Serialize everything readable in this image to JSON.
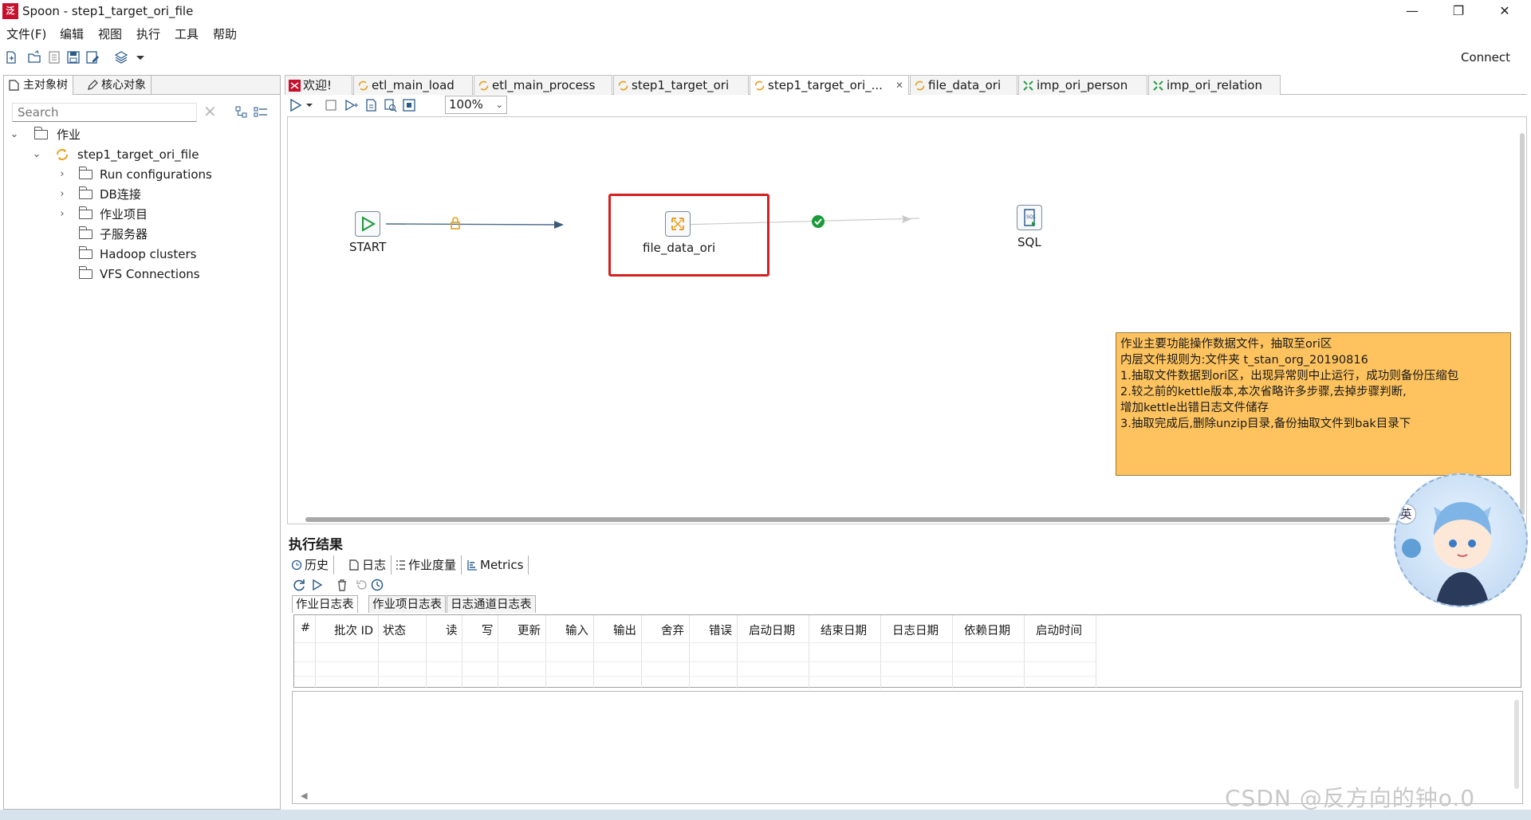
{
  "window": {
    "app_icon_text": "泛",
    "title": "Spoon - step1_target_ori_file",
    "minimize": "—",
    "restore": "❐",
    "close": "✕"
  },
  "menu": [
    "文件(F)",
    "编辑",
    "视图",
    "执行",
    "工具",
    "帮助"
  ],
  "toolbar": {
    "connect": "Connect"
  },
  "left_panel": {
    "tabs": [
      "主对象树",
      "核心对象"
    ],
    "search_placeholder": "Search",
    "tree": [
      {
        "label": "作业",
        "level": 0,
        "expanded": true,
        "icon": "folder-icon"
      },
      {
        "label": "step1_target_ori_file",
        "level": 1,
        "expanded": true,
        "icon": "job-icon"
      },
      {
        "label": "Run configurations",
        "level": 2,
        "expandable": true,
        "icon": "folder-icon"
      },
      {
        "label": "DB连接",
        "level": 2,
        "expandable": true,
        "icon": "folder-icon"
      },
      {
        "label": "作业项目",
        "level": 2,
        "expandable": true,
        "icon": "folder-icon"
      },
      {
        "label": "子服务器",
        "level": 2,
        "expandable": false,
        "icon": "folder-icon"
      },
      {
        "label": "Hadoop clusters",
        "level": 2,
        "expandable": false,
        "icon": "folder-icon"
      },
      {
        "label": "VFS Connections",
        "level": 2,
        "expandable": false,
        "icon": "folder-icon"
      }
    ]
  },
  "editor": {
    "tabs": [
      {
        "label": "欢迎!",
        "icon": "welcome-icon"
      },
      {
        "label": "etl_main_load",
        "icon": "job-icon"
      },
      {
        "label": "etl_main_process",
        "icon": "job-icon"
      },
      {
        "label": "step1_target_ori",
        "icon": "job-icon"
      },
      {
        "label": "step1_target_ori_...",
        "icon": "job-icon",
        "active": true,
        "closable": true
      },
      {
        "label": "file_data_ori",
        "icon": "job-icon"
      },
      {
        "label": "imp_ori_person",
        "icon": "transform-icon"
      },
      {
        "label": "imp_ori_relation",
        "icon": "transform-icon"
      }
    ],
    "close_glyph": "✕",
    "zoom": "100%",
    "zoom_arrow": "⌄",
    "nodes": {
      "start": "START",
      "file_data_ori": "file_data_ori",
      "sql": "SQL"
    },
    "note_lines": [
      "作业主要功能操作数据文件，抽取至ori区",
      "内层文件规则为:文件夹 t_stan_org_20190816",
      "1.抽取文件数据到ori区，出现异常则中止运行，成功则备份压缩包",
      "2.较之前的kettle版本,本次省略许多步骤,去掉步骤判断,",
      "增加kettle出错日志文件储存",
      "3.抽取完成后,删除unzip目录,备份抽取文件到bak目录下"
    ],
    "highlight_color": "#d42020",
    "note_color": "#fec35e"
  },
  "results": {
    "title": "执行结果",
    "tabs": [
      "历史",
      "日志",
      "作业度量",
      "Metrics"
    ],
    "sub_tabs": [
      "作业日志表",
      "作业项日志表",
      "日志通道日志表"
    ],
    "columns": [
      "#",
      "批次 ID",
      "状态",
      "读",
      "写",
      "更新",
      "输入",
      "输出",
      "舍弃",
      "错误",
      "启动日期",
      "结束日期",
      "日志日期",
      "依赖日期",
      "启动时间"
    ]
  },
  "overlay": {
    "mascot_badge": "英",
    "watermark": "CSDN @反方向的钟o.0"
  }
}
